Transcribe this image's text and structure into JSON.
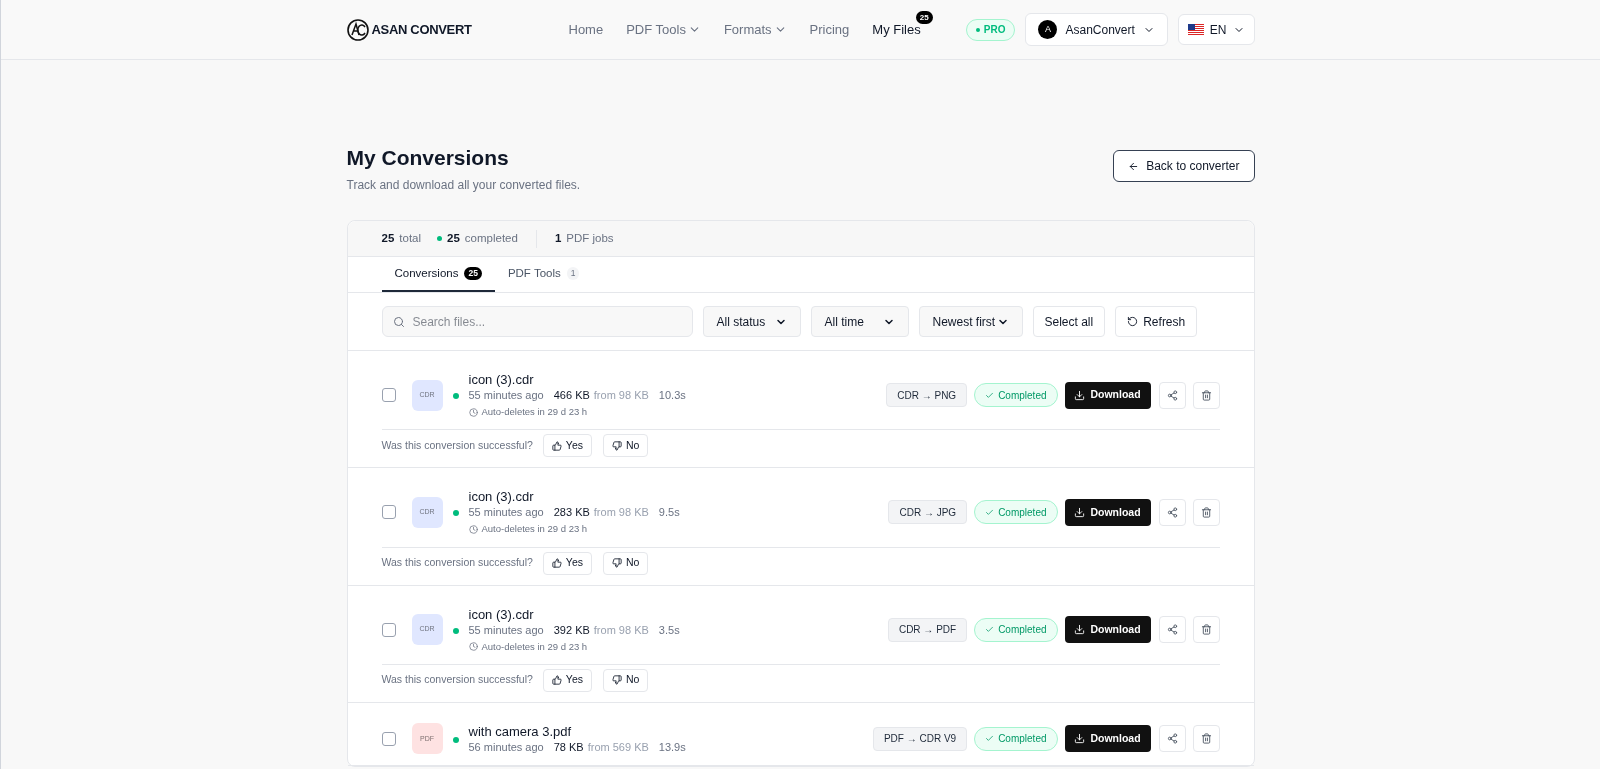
{
  "nav": {
    "brand": "ASAN CONVERT",
    "links": [
      {
        "label": "Home",
        "dropdown": false,
        "selected": false
      },
      {
        "label": "PDF Tools",
        "dropdown": true,
        "selected": false
      },
      {
        "label": "Formats",
        "dropdown": true,
        "selected": false
      },
      {
        "label": "Pricing",
        "dropdown": false,
        "selected": false
      },
      {
        "label": "My Files",
        "dropdown": false,
        "selected": true,
        "badge": "25"
      }
    ],
    "plan": "PRO",
    "account": {
      "initial": "A",
      "name": "AsanConvert"
    },
    "language": "EN"
  },
  "page": {
    "title": "My Conversions",
    "subtitle": "Track and download all your converted files.",
    "back_button": "Back to converter"
  },
  "stats": [
    {
      "value": "25",
      "label": "total",
      "dot": false
    },
    {
      "value": "25",
      "label": "completed",
      "dot": true
    },
    {
      "value": "1",
      "label": "PDF jobs",
      "dot": false
    }
  ],
  "tabs": [
    {
      "label": "Conversions",
      "count": "25",
      "selected": true
    },
    {
      "label": "PDF Tools",
      "count": "1",
      "selected": false
    }
  ],
  "toolbar": {
    "search_placeholder": "Search files...",
    "filters": [
      "All status",
      "All time",
      "Newest first"
    ],
    "select_all": "Select all",
    "refresh": "Refresh"
  },
  "files": [
    {
      "type": "CDR",
      "color": "#e0e7ff",
      "name": "icon (3).cdr",
      "age": "55 minutes ago",
      "size": "466 KB",
      "source": "from 98 KB",
      "duration": "10.3s",
      "expiry": "Auto-deletes in 29 d 23 h",
      "conversion": "CDR → PNG",
      "status": "Completed",
      "checked": false,
      "download": "Download",
      "question": "Was this conversion successful?",
      "yes": "Yes",
      "no": "No"
    },
    {
      "type": "CDR",
      "color": "#e0e7ff",
      "name": "icon (3).cdr",
      "age": "55 minutes ago",
      "size": "283 KB",
      "source": "from 98 KB",
      "duration": "9.5s",
      "expiry": "Auto-deletes in 29 d 23 h",
      "conversion": "CDR → JPG",
      "status": "Completed",
      "checked": false,
      "download": "Download",
      "question": "Was this conversion successful?",
      "yes": "Yes",
      "no": "No"
    },
    {
      "type": "CDR",
      "color": "#e0e7ff",
      "name": "icon (3).cdr",
      "age": "55 minutes ago",
      "size": "392 KB",
      "source": "from 98 KB",
      "duration": "3.5s",
      "expiry": "Auto-deletes in 29 d 23 h",
      "conversion": "CDR → PDF",
      "status": "Completed",
      "checked": false,
      "download": "Download",
      "question": "Was this conversion successful?",
      "yes": "Yes",
      "no": "No"
    },
    {
      "type": "PDF",
      "color": "#fee2e2",
      "name": "with camera 3.pdf",
      "age": "56 minutes ago",
      "size": "78 KB",
      "source": "from 569 KB",
      "duration": "13.9s",
      "conversion": "PDF → CDR V9",
      "status": "Completed",
      "checked": false,
      "download": "Download"
    }
  ]
}
